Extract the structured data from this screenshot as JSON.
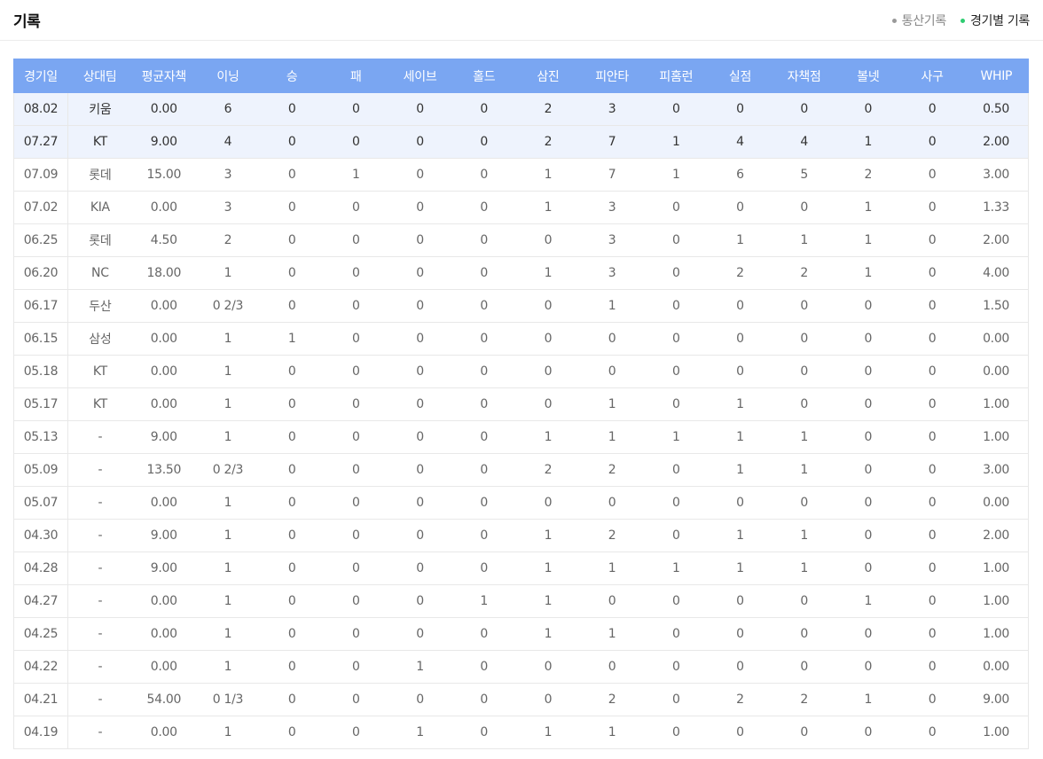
{
  "header": {
    "title": "기록",
    "tabs": [
      {
        "label": "통산기록",
        "active": false,
        "dot_color": "#999999"
      },
      {
        "label": "경기별 기록",
        "active": true,
        "dot_color": "#2ecc71"
      }
    ]
  },
  "table": {
    "columns": [
      "경기일",
      "상대팀",
      "평균자책",
      "이닝",
      "승",
      "패",
      "세이브",
      "홀드",
      "삼진",
      "피안타",
      "피홈런",
      "실점",
      "자책점",
      "볼넷",
      "사구",
      "WHIP"
    ],
    "header_color": "#7aa6f2",
    "highlight_color": "#eef3fd",
    "rows": [
      {
        "highlight": true,
        "cells": [
          "08.02",
          "키움",
          "0.00",
          "6",
          "0",
          "0",
          "0",
          "0",
          "2",
          "3",
          "0",
          "0",
          "0",
          "0",
          "0",
          "0.50"
        ]
      },
      {
        "highlight": true,
        "cells": [
          "07.27",
          "KT",
          "9.00",
          "4",
          "0",
          "0",
          "0",
          "0",
          "2",
          "7",
          "1",
          "4",
          "4",
          "1",
          "0",
          "2.00"
        ]
      },
      {
        "highlight": false,
        "cells": [
          "07.09",
          "롯데",
          "15.00",
          "3",
          "0",
          "1",
          "0",
          "0",
          "1",
          "7",
          "1",
          "6",
          "5",
          "2",
          "0",
          "3.00"
        ]
      },
      {
        "highlight": false,
        "cells": [
          "07.02",
          "KIA",
          "0.00",
          "3",
          "0",
          "0",
          "0",
          "0",
          "1",
          "3",
          "0",
          "0",
          "0",
          "1",
          "0",
          "1.33"
        ]
      },
      {
        "highlight": false,
        "cells": [
          "06.25",
          "롯데",
          "4.50",
          "2",
          "0",
          "0",
          "0",
          "0",
          "0",
          "3",
          "0",
          "1",
          "1",
          "1",
          "0",
          "2.00"
        ]
      },
      {
        "highlight": false,
        "cells": [
          "06.20",
          "NC",
          "18.00",
          "1",
          "0",
          "0",
          "0",
          "0",
          "1",
          "3",
          "0",
          "2",
          "2",
          "1",
          "0",
          "4.00"
        ]
      },
      {
        "highlight": false,
        "cells": [
          "06.17",
          "두산",
          "0.00",
          "0 2/3",
          "0",
          "0",
          "0",
          "0",
          "0",
          "1",
          "0",
          "0",
          "0",
          "0",
          "0",
          "1.50"
        ]
      },
      {
        "highlight": false,
        "cells": [
          "06.15",
          "삼성",
          "0.00",
          "1",
          "1",
          "0",
          "0",
          "0",
          "0",
          "0",
          "0",
          "0",
          "0",
          "0",
          "0",
          "0.00"
        ]
      },
      {
        "highlight": false,
        "cells": [
          "05.18",
          "KT",
          "0.00",
          "1",
          "0",
          "0",
          "0",
          "0",
          "0",
          "0",
          "0",
          "0",
          "0",
          "0",
          "0",
          "0.00"
        ]
      },
      {
        "highlight": false,
        "cells": [
          "05.17",
          "KT",
          "0.00",
          "1",
          "0",
          "0",
          "0",
          "0",
          "0",
          "1",
          "0",
          "1",
          "0",
          "0",
          "0",
          "1.00"
        ]
      },
      {
        "highlight": false,
        "cells": [
          "05.13",
          "-",
          "9.00",
          "1",
          "0",
          "0",
          "0",
          "0",
          "1",
          "1",
          "1",
          "1",
          "1",
          "0",
          "0",
          "1.00"
        ]
      },
      {
        "highlight": false,
        "cells": [
          "05.09",
          "-",
          "13.50",
          "0 2/3",
          "0",
          "0",
          "0",
          "0",
          "2",
          "2",
          "0",
          "1",
          "1",
          "0",
          "0",
          "3.00"
        ]
      },
      {
        "highlight": false,
        "cells": [
          "05.07",
          "-",
          "0.00",
          "1",
          "0",
          "0",
          "0",
          "0",
          "0",
          "0",
          "0",
          "0",
          "0",
          "0",
          "0",
          "0.00"
        ]
      },
      {
        "highlight": false,
        "cells": [
          "04.30",
          "-",
          "9.00",
          "1",
          "0",
          "0",
          "0",
          "0",
          "1",
          "2",
          "0",
          "1",
          "1",
          "0",
          "0",
          "2.00"
        ]
      },
      {
        "highlight": false,
        "cells": [
          "04.28",
          "-",
          "9.00",
          "1",
          "0",
          "0",
          "0",
          "0",
          "1",
          "1",
          "1",
          "1",
          "1",
          "0",
          "0",
          "1.00"
        ]
      },
      {
        "highlight": false,
        "cells": [
          "04.27",
          "-",
          "0.00",
          "1",
          "0",
          "0",
          "0",
          "1",
          "1",
          "0",
          "0",
          "0",
          "0",
          "1",
          "0",
          "1.00"
        ]
      },
      {
        "highlight": false,
        "cells": [
          "04.25",
          "-",
          "0.00",
          "1",
          "0",
          "0",
          "0",
          "0",
          "1",
          "1",
          "0",
          "0",
          "0",
          "0",
          "0",
          "1.00"
        ]
      },
      {
        "highlight": false,
        "cells": [
          "04.22",
          "-",
          "0.00",
          "1",
          "0",
          "0",
          "1",
          "0",
          "0",
          "0",
          "0",
          "0",
          "0",
          "0",
          "0",
          "0.00"
        ]
      },
      {
        "highlight": false,
        "cells": [
          "04.21",
          "-",
          "54.00",
          "0 1/3",
          "0",
          "0",
          "0",
          "0",
          "0",
          "2",
          "0",
          "2",
          "2",
          "1",
          "0",
          "9.00"
        ]
      },
      {
        "highlight": false,
        "cells": [
          "04.19",
          "-",
          "0.00",
          "1",
          "0",
          "0",
          "1",
          "0",
          "1",
          "1",
          "0",
          "0",
          "0",
          "0",
          "0",
          "1.00"
        ]
      }
    ]
  }
}
